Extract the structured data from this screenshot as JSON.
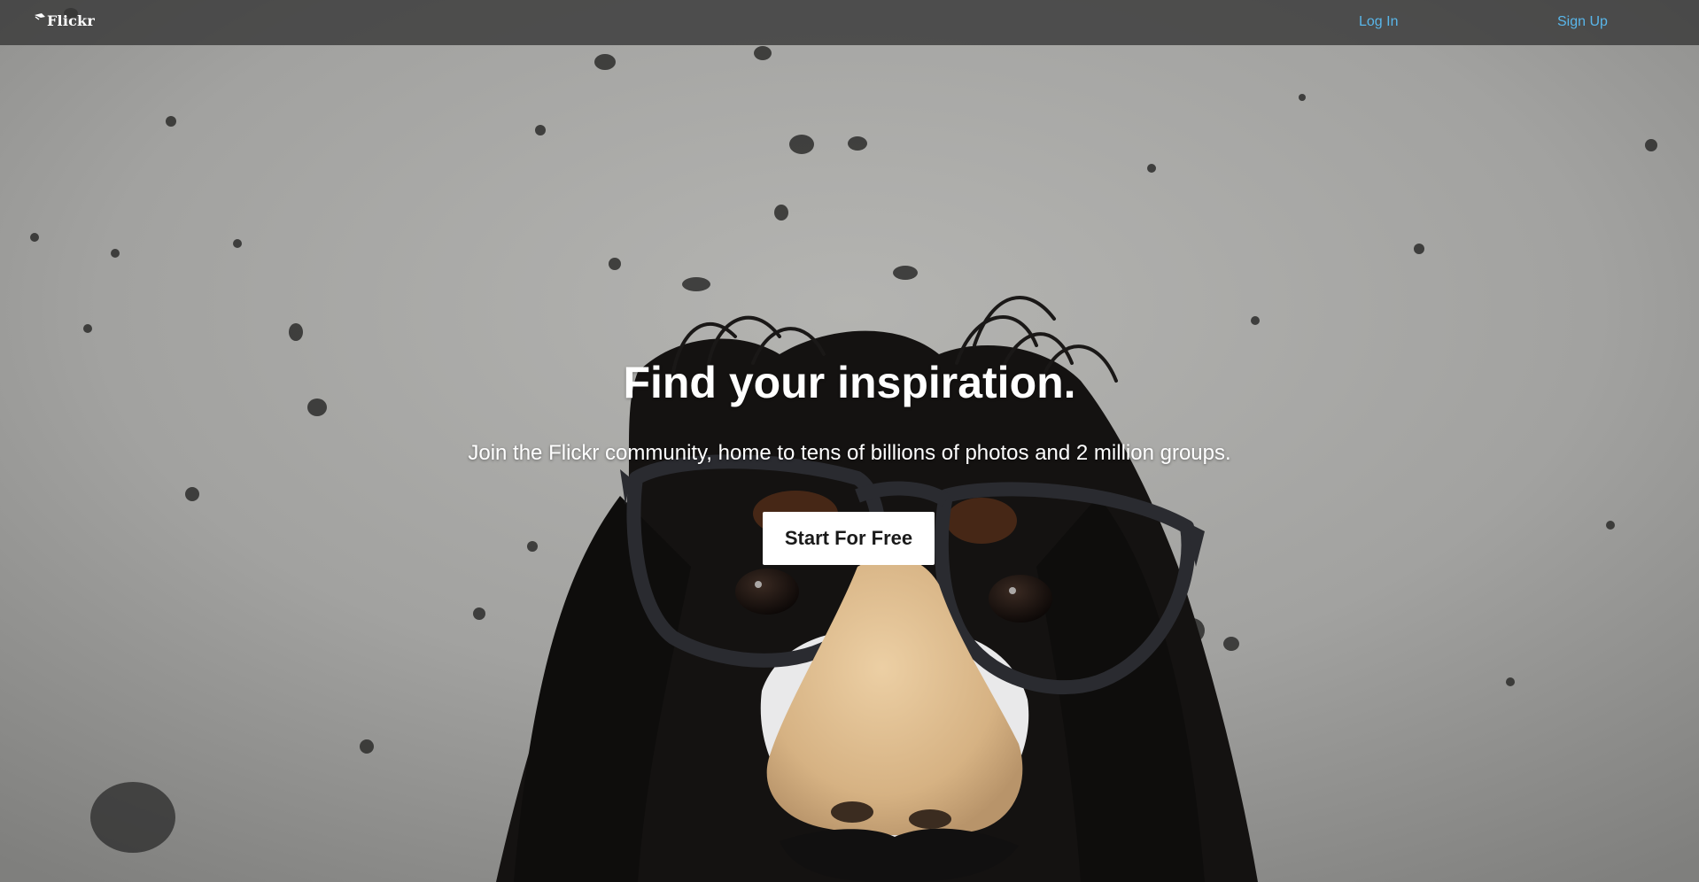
{
  "header": {
    "logo_text": "Flickr",
    "logo_icon": "flickr-logo-icon",
    "nav": {
      "login_label": "Log In",
      "signup_label": "Sign Up"
    }
  },
  "hero": {
    "title": "Find your inspiration.",
    "subtitle": "Join the Flickr community, home to tens of billions of photos and 2 million groups.",
    "cta_label": "Start For Free",
    "background_image": "dog-with-glasses-nose-disguise-photo"
  },
  "colors": {
    "topbar_bg": "#373737",
    "nav_link": "#59b6ea",
    "hero_text": "#ffffff",
    "cta_bg": "#ffffff",
    "cta_text": "#1a1a1a"
  }
}
